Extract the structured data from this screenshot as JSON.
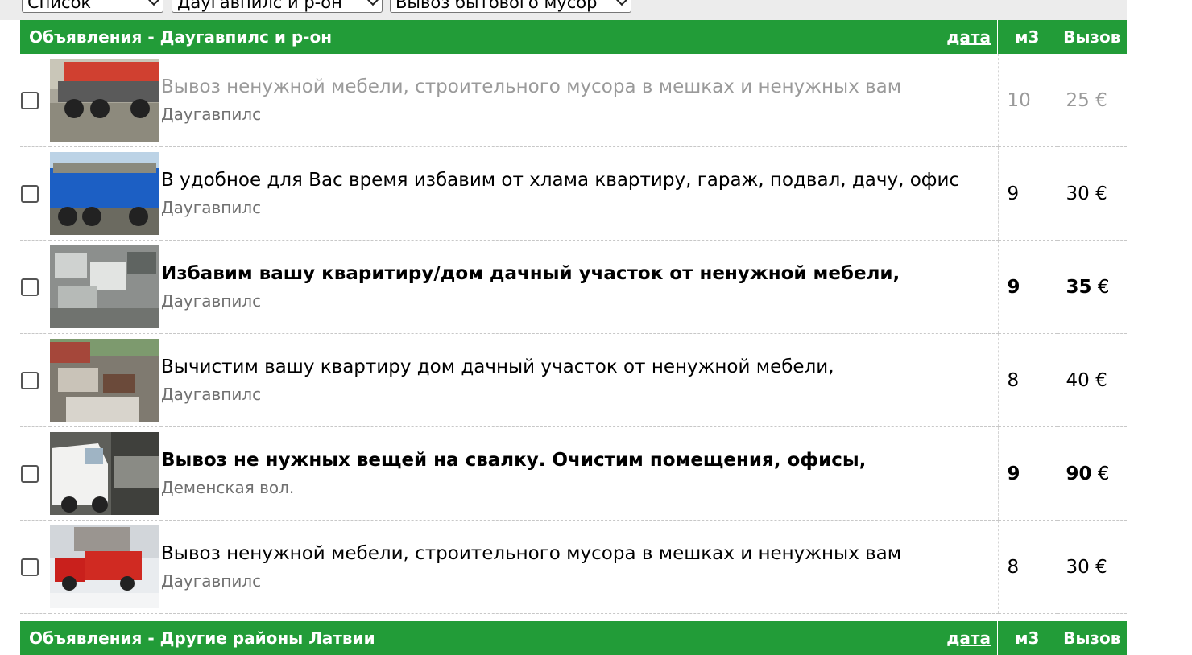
{
  "filters": {
    "view": "Список",
    "region": "Даугавпилс и р-он",
    "category": "Вывоз бытового мусор"
  },
  "section1": {
    "title": "Объявления - Даугавпилс и р-он",
    "sort_date": "дата",
    "col_m3": "м3",
    "col_price": "Вызов"
  },
  "ads": [
    {
      "text": "Вывоз ненужной мебели, строительного мусора в мешках и ненужных вам",
      "location": "Даугавпилс",
      "m3": "10",
      "price": "25",
      "currency": "€"
    },
    {
      "text": "В удобное для Вас время избавим от хлама квартиру, гараж, подвал, дачу, офис",
      "location": "Даугавпилс",
      "m3": "9",
      "price": "30",
      "currency": "€"
    },
    {
      "text": "Избавим вашу кваритиру/дом дачный участок от ненужной мебели,",
      "location": "Даугавпилс",
      "m3": "9",
      "price": "35",
      "currency": "€"
    },
    {
      "text": "Вычистим вашу квартиру дом дачный участок от ненужной мебели,",
      "location": "Даугавпилс",
      "m3": "8",
      "price": "40",
      "currency": "€"
    },
    {
      "text": "Вывоз не нужных вещей на свалку. Очистим помещения, офисы,",
      "location": "Деменская вол.",
      "m3": "9",
      "price": "90",
      "currency": "€"
    },
    {
      "text": "Вывоз ненужной мебели, строительного мусора в мешках и ненужных вам",
      "location": "Даугавпилс",
      "m3": "8",
      "price": "30",
      "currency": "€"
    }
  ],
  "section2": {
    "title": "Объявления - Другие районы Латвии",
    "sort_date": "дата",
    "col_m3": "м3",
    "col_price": "Вызов"
  }
}
